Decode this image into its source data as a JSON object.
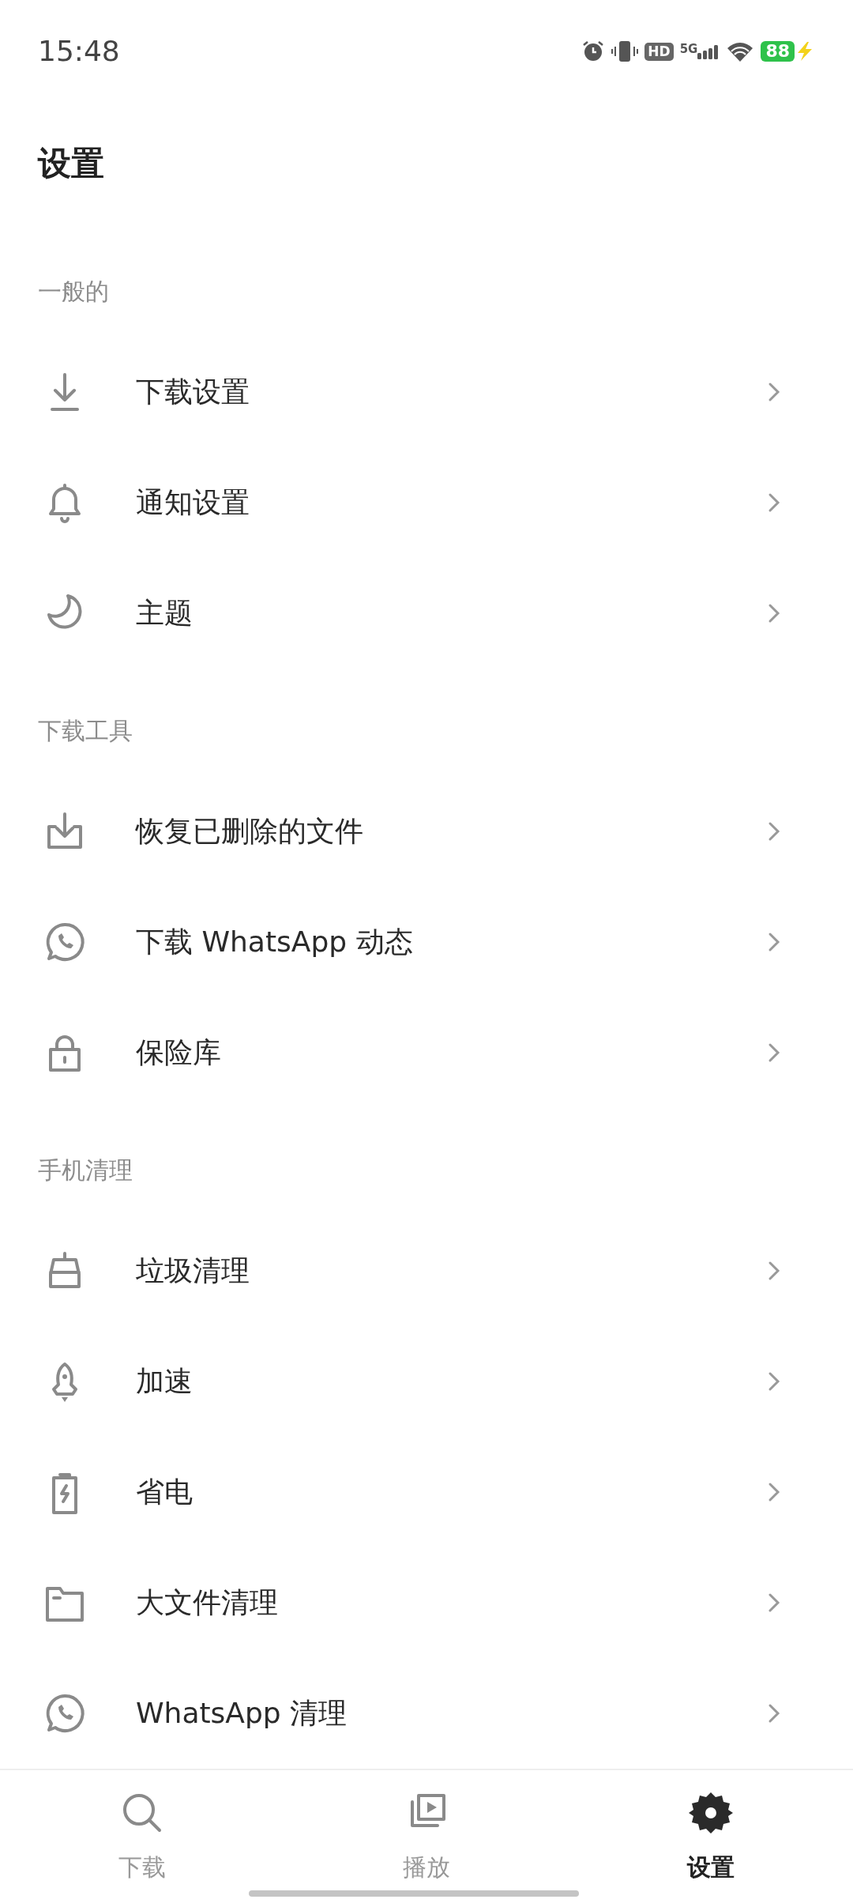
{
  "status_bar": {
    "time": "15:48",
    "hd_badge": "HD",
    "network": "5G",
    "battery": "88"
  },
  "title": "设置",
  "sections": [
    {
      "header": "一般的",
      "items": [
        {
          "kind": "download",
          "label": "下载设置"
        },
        {
          "kind": "bell",
          "label": "通知设置"
        },
        {
          "kind": "moon",
          "label": "主题"
        }
      ]
    },
    {
      "header": "下载工具",
      "items": [
        {
          "kind": "tray",
          "label": "恢复已删除的文件"
        },
        {
          "kind": "chat",
          "label": "下载 WhatsApp 动态"
        },
        {
          "kind": "lock",
          "label": "保险库"
        }
      ]
    },
    {
      "header": "手机清理",
      "items": [
        {
          "kind": "basket",
          "label": "垃圾清理"
        },
        {
          "kind": "rocket",
          "label": "加速"
        },
        {
          "kind": "battery",
          "label": "省电"
        },
        {
          "kind": "folder",
          "label": "大文件清理"
        },
        {
          "kind": "chat",
          "label": "WhatsApp 清理"
        }
      ]
    }
  ],
  "bottom_nav": [
    {
      "kind": "search",
      "label": "下载",
      "selected": false
    },
    {
      "kind": "play",
      "label": "播放",
      "selected": false
    },
    {
      "kind": "gear",
      "label": "设置",
      "selected": true
    }
  ]
}
